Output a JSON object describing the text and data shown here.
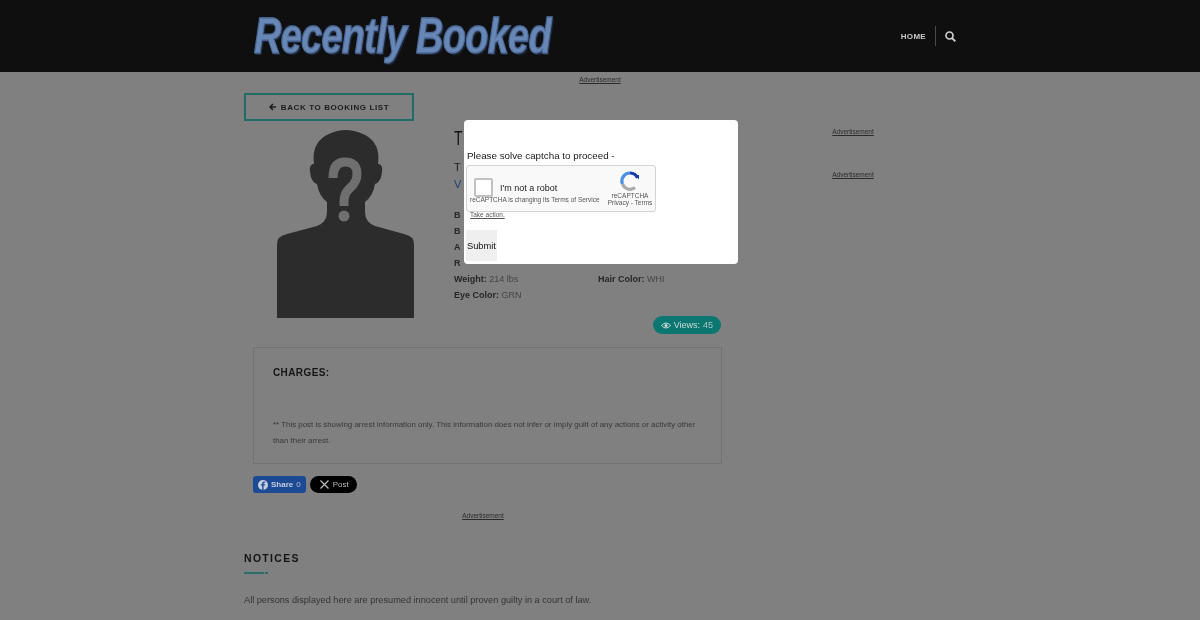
{
  "header": {
    "logo": "Recently Booked",
    "nav": [
      {
        "label": "HOME"
      }
    ]
  },
  "top_ad": "Advertisement",
  "back_link": "BACK TO BOOKING LIST",
  "profile": {
    "name": "T",
    "subtitle": "T",
    "link": "V",
    "rows": [
      {
        "cells": [
          {
            "label": "B"
          }
        ]
      },
      {
        "cells": [
          {
            "label": "B"
          }
        ]
      },
      {
        "cells": [
          {
            "label": "A"
          }
        ]
      },
      {
        "cells": [
          {
            "label": "R"
          }
        ]
      },
      {
        "cells": [
          {
            "label": "Weight:",
            "value": "214 lbs"
          },
          {
            "label": "Hair Color:",
            "value": "WHI"
          }
        ]
      },
      {
        "cells": [
          {
            "label": "Eye Color:",
            "value": "GRN"
          }
        ]
      }
    ]
  },
  "side_ads": [
    "Advertisement",
    "Advertisement"
  ],
  "views": {
    "label": "Views:",
    "count": "45"
  },
  "charges": {
    "title": "CHARGES:",
    "note": "** This post is showing arrest information only. This information does not infer or imply guilt of any actions or activity other than their arrest."
  },
  "share_buttons": [
    {
      "kind": "facebook",
      "label": "Share",
      "count": "0"
    },
    {
      "kind": "x",
      "label": "Post"
    }
  ],
  "bottom_ad": "Advertisement",
  "notices": {
    "title": "NOTICES",
    "text": "All persons displayed here are presumed innocent until proven guilty in a court of law."
  },
  "captcha_dialog": {
    "prompt": "Please solve captcha to proceed -",
    "widget": {
      "checked": false,
      "label": "I'm not a robot",
      "notice": "reCAPTCHA is changing its Terms of Service",
      "notice_link": "Take action.",
      "brand": "reCAPTCHA",
      "footer": "Privacy - Terms"
    },
    "submit": "Submit"
  }
}
